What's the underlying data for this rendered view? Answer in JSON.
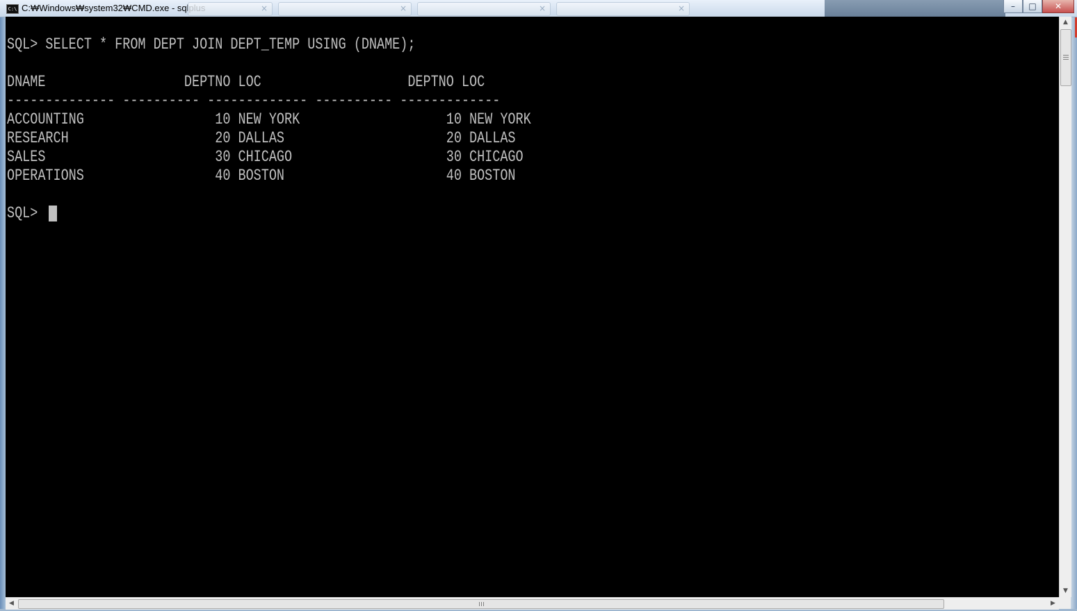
{
  "window": {
    "title": "C:₩Windows₩system32₩CMD.exe - sqlplus",
    "icon": "cmd-icon",
    "controls": {
      "minimize": "–",
      "maximize": "□",
      "close": "✕"
    }
  },
  "console": {
    "lines": [
      "SQL> SELECT * FROM DEPT JOIN DEPT_TEMP USING (DNAME);",
      "",
      "DNAME                  DEPTNO LOC                   DEPTNO LOC",
      "-------------- ---------- ------------- ---------- -------------",
      "ACCOUNTING                 10 NEW YORK                   10 NEW YORK",
      "RESEARCH                   20 DALLAS                     20 DALLAS",
      "SALES                      30 CHICAGO                    30 CHICAGO",
      "OPERATIONS                 40 BOSTON                     40 BOSTON",
      "",
      "SQL> "
    ]
  },
  "scrollbars": {
    "up_arrow": "▲",
    "down_arrow": "▼",
    "left_arrow": "◀",
    "right_arrow": "▶"
  }
}
